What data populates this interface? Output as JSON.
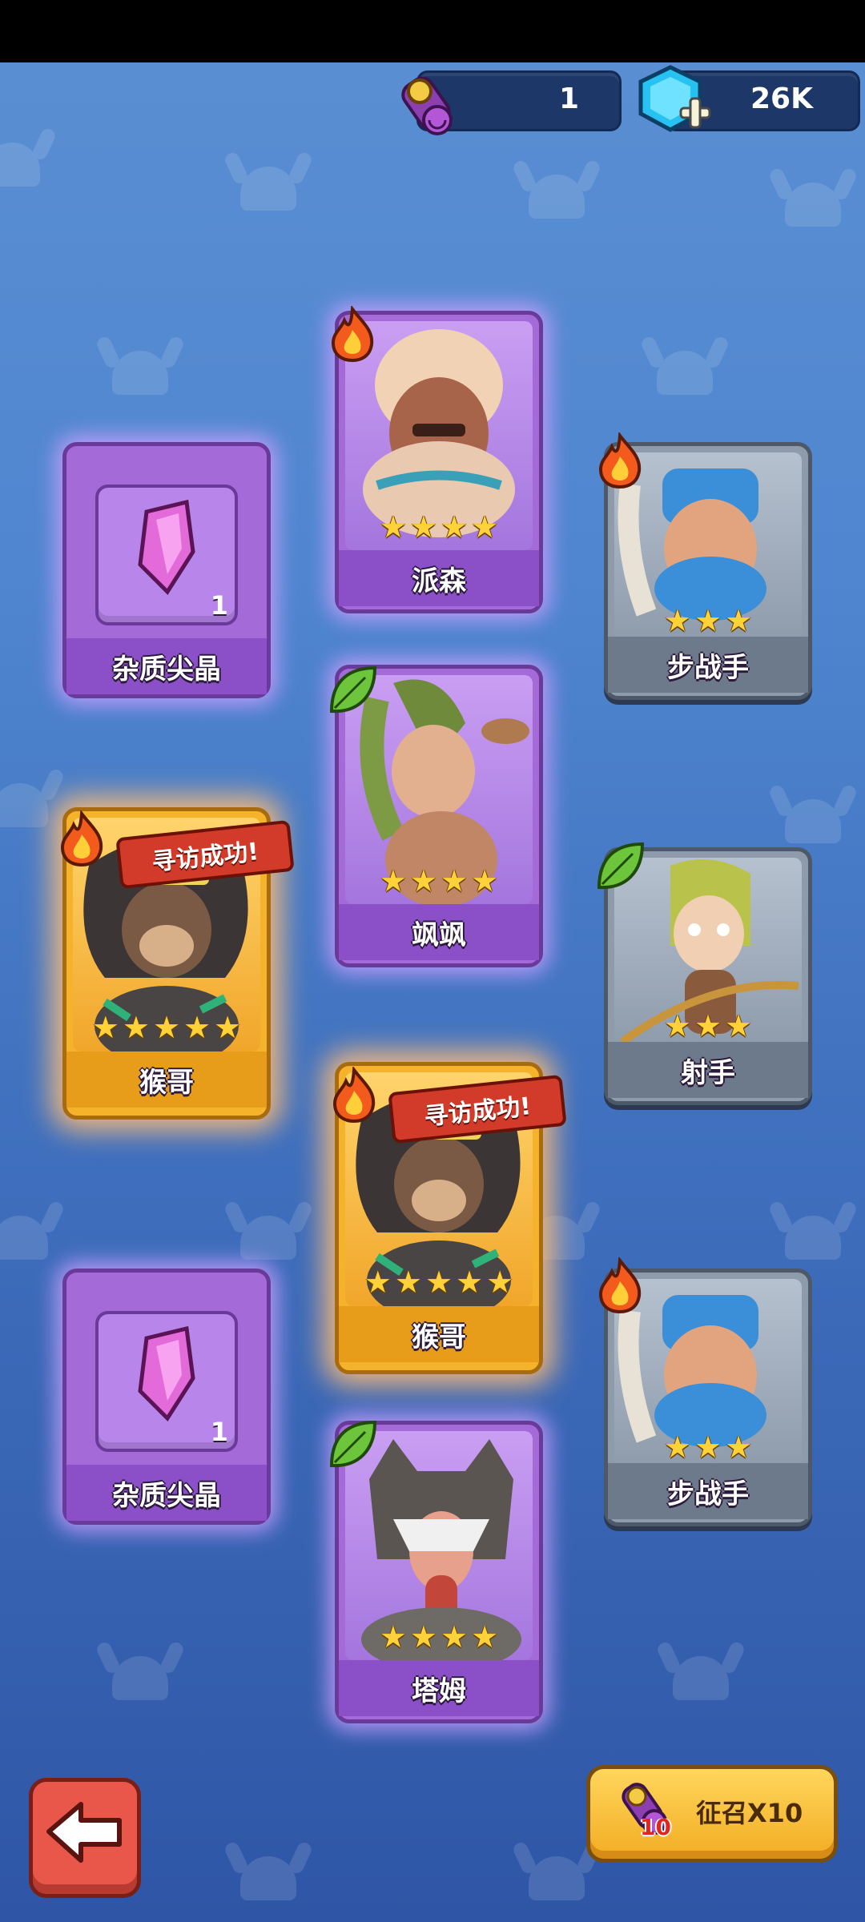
{
  "currency": {
    "scroll_icon": "recruit-scroll-icon",
    "scroll_count": "1",
    "gem_icon": "blue-gem-plus-icon",
    "gem_amount": "26K"
  },
  "cards": [
    {
      "id": "card-paisen",
      "name": "派森",
      "rarity": "purple",
      "element": "fire",
      "stars": 4
    },
    {
      "id": "card-crystal-1",
      "name": "杂质尖晶",
      "rarity": "purple",
      "item": "crystal",
      "count": "1"
    },
    {
      "id": "card-infantry-1",
      "name": "步战手",
      "rarity": "gray",
      "element": "fire",
      "stars": 3
    },
    {
      "id": "card-sasa",
      "name": "飒飒",
      "rarity": "purple",
      "element": "leaf",
      "stars": 4
    },
    {
      "id": "card-monkey-1",
      "name": "猴哥",
      "rarity": "gold",
      "element": "fire",
      "stars": 5,
      "ribbon": "寻访成功!"
    },
    {
      "id": "card-archer",
      "name": "射手",
      "rarity": "gray",
      "element": "leaf",
      "stars": 3
    },
    {
      "id": "card-monkey-2",
      "name": "猴哥",
      "rarity": "gold",
      "element": "fire",
      "stars": 5,
      "ribbon": "寻访成功!"
    },
    {
      "id": "card-crystal-2",
      "name": "杂质尖晶",
      "rarity": "purple",
      "item": "crystal",
      "count": "1"
    },
    {
      "id": "card-infantry-2",
      "name": "步战手",
      "rarity": "gray",
      "element": "fire",
      "stars": 3
    },
    {
      "id": "card-tamu",
      "name": "塔姆",
      "rarity": "purple",
      "element": "leaf",
      "stars": 4
    }
  ],
  "buttons": {
    "back_icon": "back-arrow-icon",
    "summon_label": "征召X10",
    "summon_badge": "10"
  },
  "colors": {
    "background": "#4f86cf",
    "purple_card": "#a46ad8",
    "gray_card": "#8e9bab",
    "gold_card": "#f4b32a",
    "star": "#ffd23a"
  }
}
